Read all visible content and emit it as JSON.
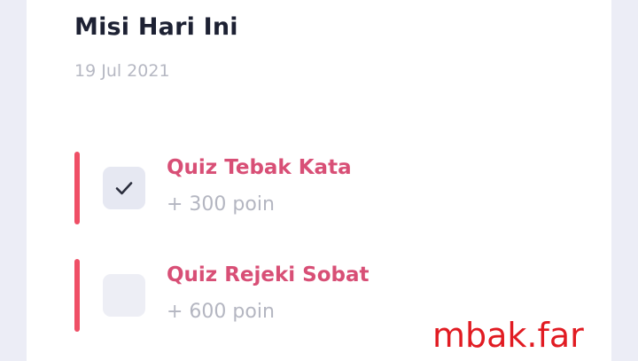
{
  "header": {
    "title": "Misi Hari Ini",
    "date": "19 Jul 2021"
  },
  "missions": [
    {
      "title": "Quiz Tebak Kata",
      "points": "+ 300 poin",
      "completed": true
    },
    {
      "title": "Quiz Rejeki Sobat",
      "points": "+ 600 poin",
      "completed": false
    }
  ],
  "watermark": "mbak.far",
  "colors": {
    "accent": "#ef4f66",
    "mission_title": "#d84f76",
    "muted_text": "#b4b6c1",
    "title_text": "#1d2133",
    "watermark": "#e11b22",
    "page_background": "#ecedf6"
  },
  "icons": {
    "check": "checkmark-icon"
  }
}
